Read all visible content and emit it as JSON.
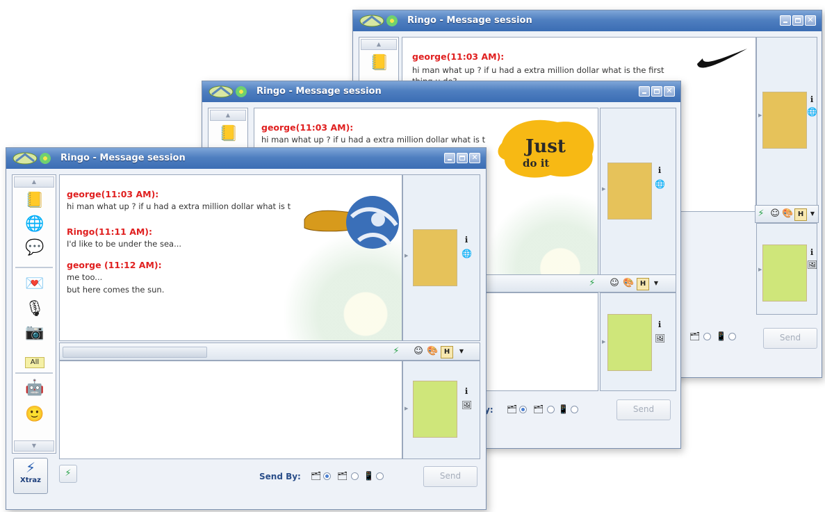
{
  "app": {
    "window_title": "Ringo - Message session"
  },
  "conversation": {
    "msg1_header": "george(11:03 AM):",
    "msg1_line1": "hi man what up ?  if u had a extra million dollar what is the first",
    "msg1_line1_mid": "hi man what up ?  if u had a extra million dollar what is t",
    "msg1_line1_front": "hi man what up ?  if u had a extra million dollar what is t",
    "msg1_line2": "thing u do?",
    "msg2_header": "Ringo(11:11 AM):",
    "msg2_text": "I'd like to be under the sea...",
    "msg3_header": "george (11:12 AM):",
    "msg3_line1": "me too...",
    "msg3_line2": "but here comes the sun."
  },
  "sidebar": {
    "all_label": "All",
    "xtraz_label": "Xtraz"
  },
  "bottombar": {
    "send_by_label": "Send By:",
    "send_by_label_clipped": "y:",
    "send_label": "Send"
  },
  "overlays": {
    "just_label": "Just",
    "do_it_label": "do it"
  },
  "toolbar": {
    "font_label": "H"
  },
  "colors": {
    "title_bar": "#3b6db4",
    "sender_name": "#e02020",
    "window_bg": "#eef2f8"
  }
}
